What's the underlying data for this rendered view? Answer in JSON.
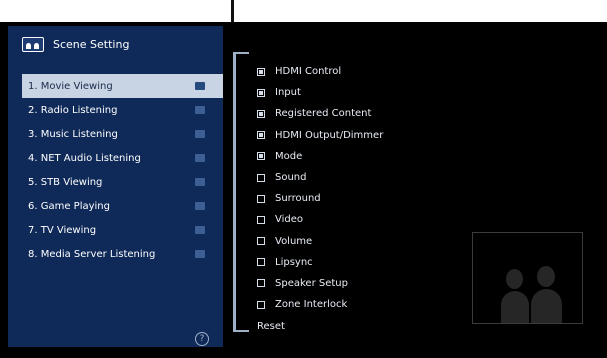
{
  "app": {
    "title": "Scene Setting",
    "icon": "scene-icon"
  },
  "scenes": [
    {
      "label": "1. Movie Viewing",
      "selected": true
    },
    {
      "label": "2. Radio Listening",
      "selected": false
    },
    {
      "label": "3. Music Listening",
      "selected": false
    },
    {
      "label": "4. NET Audio Listening",
      "selected": false
    },
    {
      "label": "5. STB Viewing",
      "selected": false
    },
    {
      "label": "6. Game Playing",
      "selected": false
    },
    {
      "label": "7. TV Viewing",
      "selected": false
    },
    {
      "label": "8. Media Server Listening",
      "selected": false
    }
  ],
  "options": [
    {
      "label": "HDMI Control",
      "checked": true
    },
    {
      "label": "Input",
      "checked": true
    },
    {
      "label": "Registered Content",
      "checked": true
    },
    {
      "label": "HDMI Output/Dimmer",
      "checked": true
    },
    {
      "label": "Mode",
      "checked": true
    },
    {
      "label": "Sound",
      "checked": false
    },
    {
      "label": "Surround",
      "checked": false
    },
    {
      "label": "Video",
      "checked": false
    },
    {
      "label": "Volume",
      "checked": false
    },
    {
      "label": "Lipsync",
      "checked": false
    },
    {
      "label": "Speaker Setup",
      "checked": false
    },
    {
      "label": "Zone Interlock",
      "checked": false
    }
  ],
  "reset_label": "Reset",
  "help_icon": "?",
  "colors": {
    "panel": "#0f2a59",
    "selected": "#c8d3e3",
    "background": "#000000"
  }
}
